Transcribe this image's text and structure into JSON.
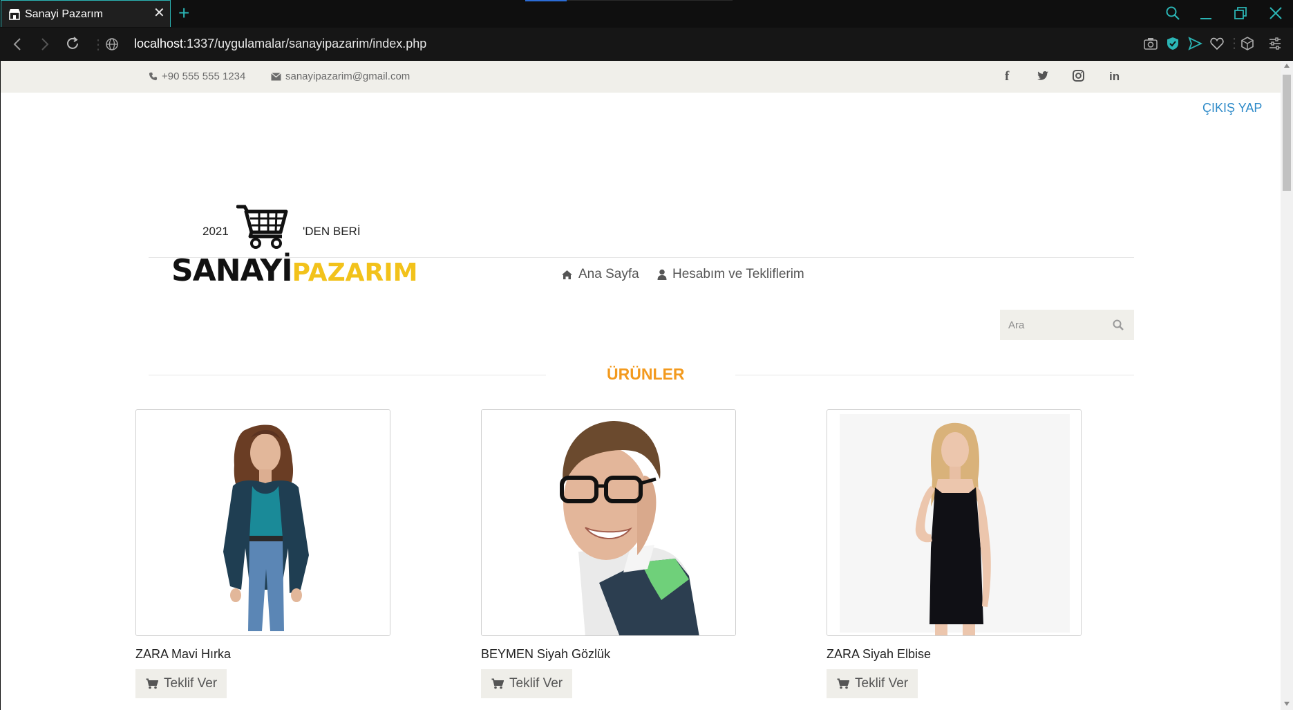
{
  "browser": {
    "tab_title": "Sanayi Pazarım",
    "url_host": "localhost",
    "url_rest": ":1337/uygulamalar/sanayipazarim/index.php"
  },
  "topbar": {
    "phone": "+90 555 555 1234",
    "email": "sanayipazarim@gmail.com",
    "social": [
      "facebook-icon",
      "twitter-icon",
      "instagram-icon",
      "linkedin-icon"
    ]
  },
  "header": {
    "logout_label": "ÇIKIŞ YAP",
    "logo": {
      "year": "2021",
      "since": "'DEN BERİ",
      "word1": "SANAYİ",
      "word2": "PAZARIM"
    }
  },
  "nav": {
    "home_label": "Ana Sayfa",
    "account_label": "Hesabım ve Tekliflerim"
  },
  "search": {
    "placeholder": "Ara"
  },
  "section": {
    "title": "ÜRÜNLER"
  },
  "products": [
    {
      "name": "ZARA Mavi Hırka",
      "button": "Teklif Ver"
    },
    {
      "name": "BEYMEN Siyah Gözlük",
      "button": "Teklif Ver"
    },
    {
      "name": "ZARA Siyah Elbise",
      "button": "Teklif Ver"
    }
  ],
  "colors": {
    "accent_orange": "#f39a1e",
    "link_blue": "#2f8bc9",
    "logo_yellow": "#f2c21b",
    "browser_teal": "#2bb5b5"
  }
}
